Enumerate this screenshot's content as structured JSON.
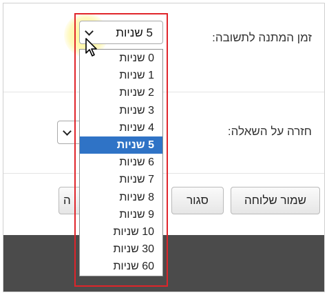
{
  "settings": {
    "time_label": "זמן המתנה לתשובה:",
    "time_value": "5 שניות",
    "repeat_label": "חזרה על השאלה:"
  },
  "dropdown": {
    "options": [
      "0 שניות",
      "1 שניות",
      "2 שניות",
      "3 שניות",
      "4 שניות",
      "5 שניות",
      "6 שניות",
      "7 שניות",
      "8 שניות",
      "9 שניות",
      "10 שניות",
      "30 שניות",
      "60 שניות"
    ],
    "selected_index": 5
  },
  "buttons": {
    "save_label": "שמור שלוחה",
    "close_label": "סגור",
    "partial_label": "ה"
  },
  "colors": {
    "selected_option": "#2f73c6",
    "annotation_box": "#e0242a",
    "bottom_band": "#4b4b4b"
  }
}
